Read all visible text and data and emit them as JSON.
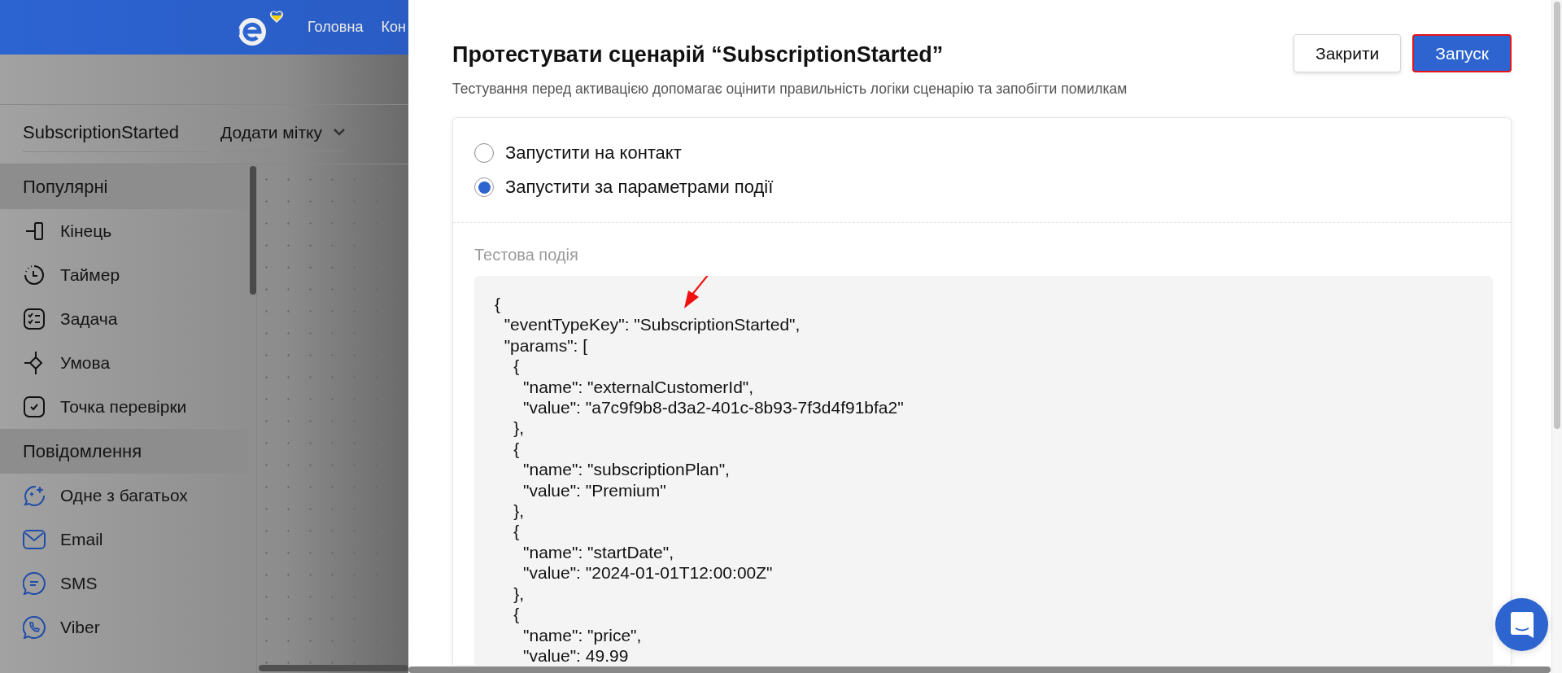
{
  "header": {
    "nav": [
      {
        "label": "Головна"
      },
      {
        "label": "Кон"
      }
    ]
  },
  "scenario": {
    "name": "SubscriptionStarted",
    "tag_dropdown": {
      "label": "Додати мітку"
    }
  },
  "sidebar": {
    "sections": [
      {
        "title": "Популярні",
        "items": [
          {
            "label": "Кінець"
          },
          {
            "label": "Таймер"
          },
          {
            "label": "Задача"
          },
          {
            "label": "Умова"
          },
          {
            "label": "Точка перевірки"
          }
        ]
      },
      {
        "title": "Повідомлення",
        "items": [
          {
            "label": "Одне з багатьох"
          },
          {
            "label": "Email"
          },
          {
            "label": "SMS"
          },
          {
            "label": "Viber"
          }
        ]
      }
    ]
  },
  "dialog": {
    "title": "Протестувати сценарій “SubscriptionStarted”",
    "subtitle": "Тестування перед активацією допомагає оцінити правильність логіки сценарію та запобігти помилкам",
    "buttons": [
      {
        "label": "Закрити",
        "kind": "secondary"
      },
      {
        "label": "Запуск",
        "kind": "primary"
      }
    ],
    "run_modes": [
      {
        "label": "Запустити на контакт",
        "selected": false
      },
      {
        "label": "Запустити за параметрами події",
        "selected": true
      }
    ],
    "event_label": "Тестова подія",
    "event_code": [
      "{",
      "  \"eventTypeKey\": \"SubscriptionStarted\",",
      "  \"params\": [",
      "    {",
      "      \"name\": \"externalCustomerId\",",
      "      \"value\": \"a7c9f9b8-d3a2-401c-8b93-7f3d4f91bfa2\"",
      "    },",
      "    {",
      "      \"name\": \"subscriptionPlan\",",
      "      \"value\": \"Premium\"",
      "    },",
      "    {",
      "      \"name\": \"startDate\",",
      "      \"value\": \"2024-01-01T12:00:00Z\"",
      "    },",
      "    {",
      "      \"name\": \"price\",",
      "      \"value\": 49.99"
    ]
  }
}
